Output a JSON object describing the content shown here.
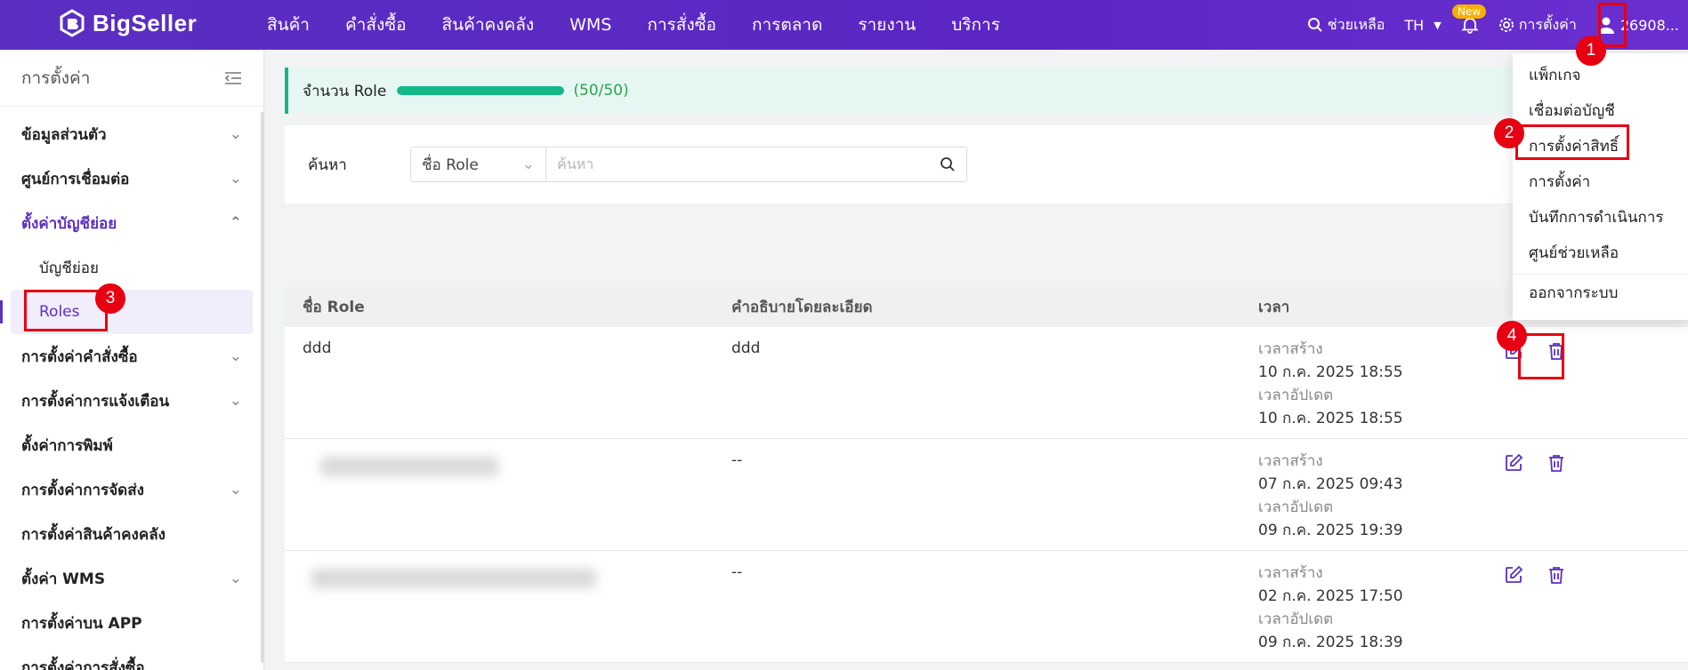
{
  "app": {
    "name": "BigSeller"
  },
  "nav": [
    "สินค้า",
    "คำสั่งซื้อ",
    "สินค้าคงคลัง",
    "WMS",
    "การสั่งซื้อ",
    "การตลาด",
    "รายงาน",
    "บริการ"
  ],
  "top_right": {
    "help": "ช่วยเหลือ",
    "lang": "TH",
    "new_badge": "New",
    "settings": "การตั้งค่า",
    "user_id": "26908..."
  },
  "sidebar": {
    "title": "การตั้งค่า",
    "items": [
      {
        "label": "ข้อมูลส่วนตัว",
        "chevron": "down"
      },
      {
        "label": "ศูนย์การเชื่อมต่อ",
        "chevron": "down"
      },
      {
        "label": "ตั้งค่าบัญชีย่อย",
        "chevron": "up"
      },
      {
        "label": "การตั้งค่าคำสั่งซื้อ",
        "chevron": "down"
      },
      {
        "label": "การตั้งค่าการแจ้งเตือน",
        "chevron": "down"
      },
      {
        "label": "ตั้งค่าการพิมพ์",
        "chevron": ""
      },
      {
        "label": "การตั้งค่าการจัดส่ง",
        "chevron": "down"
      },
      {
        "label": "การตั้งค่าสินค้าคงคลัง",
        "chevron": ""
      },
      {
        "label": "ตั้งค่า WMS",
        "chevron": "down"
      },
      {
        "label": "การตั้งค่าบน APP",
        "chevron": ""
      },
      {
        "label": "การตั้งค่าการสั่งซื้อ",
        "chevron": ""
      }
    ],
    "sub_items": [
      "บัญชีย่อย",
      "Roles"
    ]
  },
  "role_quota": {
    "label": "จำนวน Role",
    "count_text": "(50/50)",
    "progress": 1.0
  },
  "search": {
    "label": "ค้นหา",
    "field": "ชื่อ Role",
    "placeholder": "ค้นหา"
  },
  "table": {
    "headers": [
      "ชื่อ Role",
      "คำอธิบายโดยละเอียด",
      "เวลา"
    ],
    "created_label": "เวลาสร้าง",
    "updated_label": "เวลาอัปเดต",
    "rows": [
      {
        "name": "ddd",
        "desc": "ddd",
        "created": "10 ก.ค. 2025 18:55",
        "updated": "10 ก.ค. 2025 18:55"
      },
      {
        "name": "",
        "desc": "--",
        "created": "07 ก.ค. 2025 09:43",
        "updated": "09 ก.ค. 2025 19:39"
      },
      {
        "name": "",
        "desc": "--",
        "created": "02 ก.ค. 2025 17:50",
        "updated": "09 ก.ค. 2025 18:39"
      }
    ]
  },
  "user_menu": [
    "แพ็กเกจ",
    "เชื่อมต่อบัญชี",
    "การตั้งค่าสิทธิ์",
    "การตั้งค่า",
    "บันทึกการดำเนินการ",
    "ศูนย์ช่วยเหลือ",
    "ออกจากระบบ"
  ],
  "annotations": [
    "1",
    "2",
    "3",
    "4"
  ],
  "colors": {
    "brand": "#5b2fc4",
    "accent_green": "#12b886",
    "annotation_red": "#e60012"
  }
}
